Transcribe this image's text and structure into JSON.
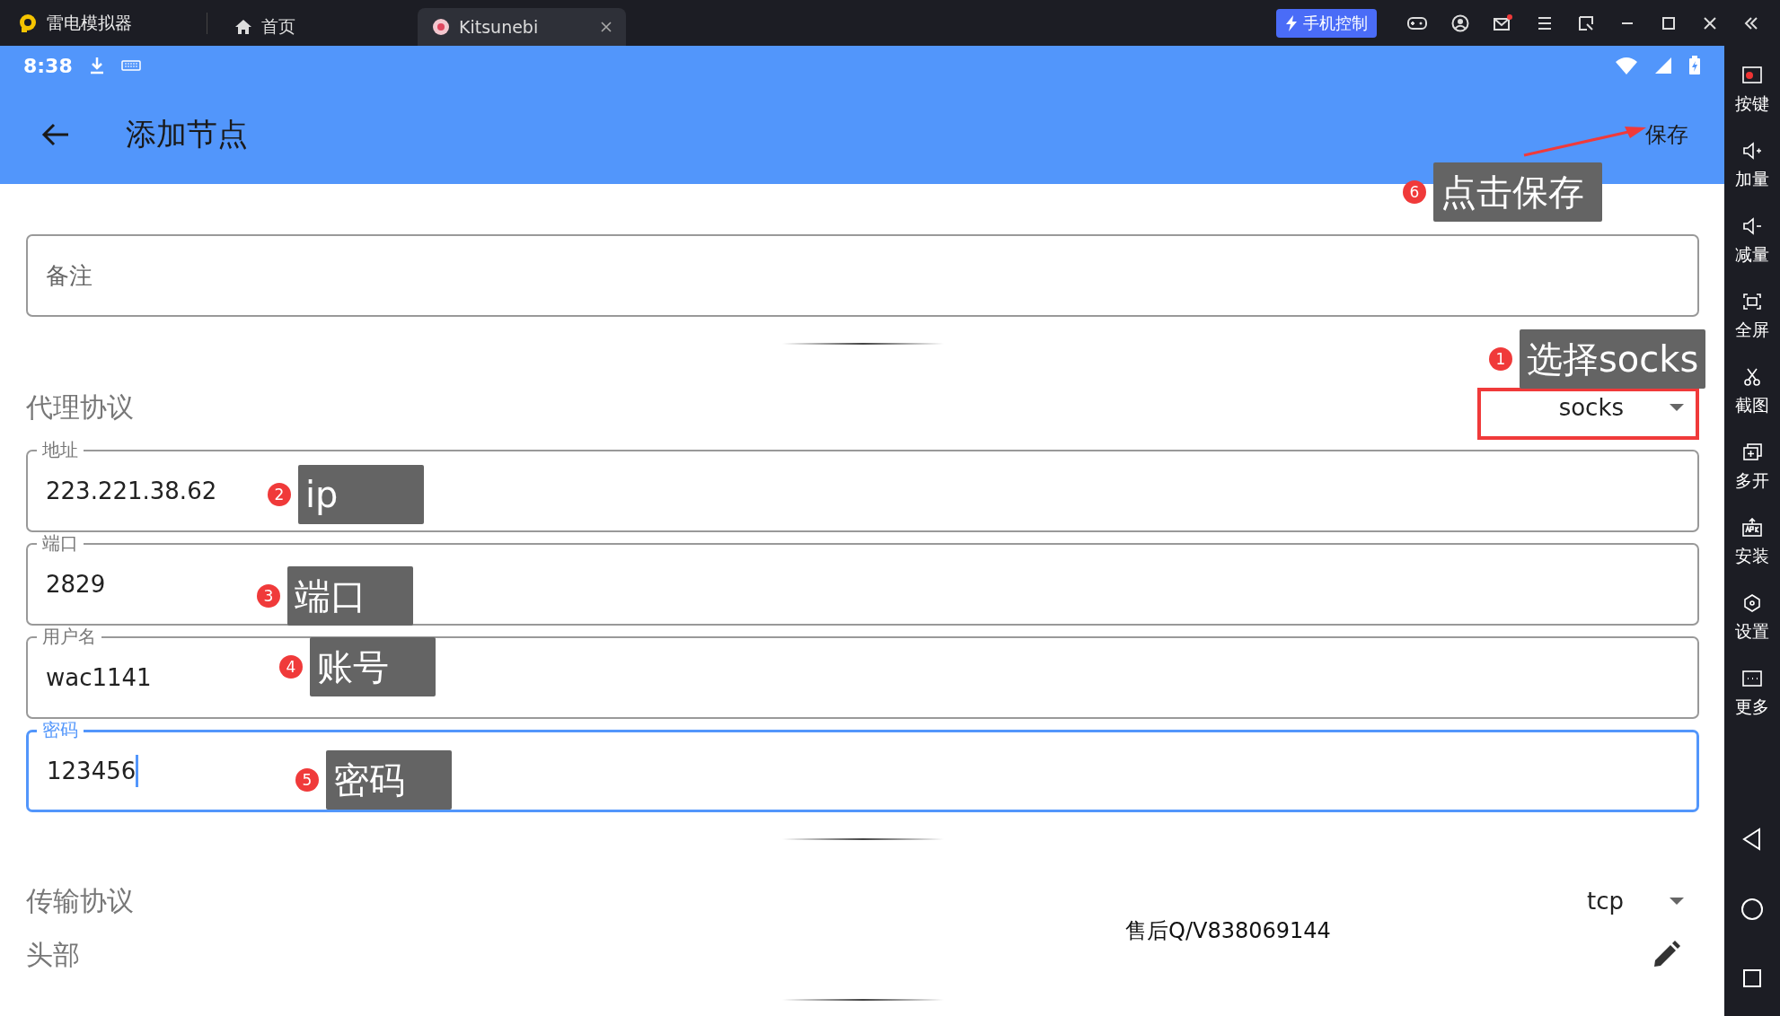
{
  "emulator": {
    "app_name": "雷电模拟器",
    "tabs": [
      {
        "label": "首页",
        "kind": "home",
        "selected": false
      },
      {
        "label": "Kitsunebi",
        "kind": "app",
        "selected": true
      }
    ],
    "control_button": "手机控制",
    "mail_unread": true,
    "sidebar": [
      {
        "label": "按键",
        "kind": "keys"
      },
      {
        "label": "加量",
        "kind": "vol-up"
      },
      {
        "label": "减量",
        "kind": "vol-down"
      },
      {
        "label": "全屏",
        "kind": "fullscreen"
      },
      {
        "label": "截图",
        "kind": "scissors"
      },
      {
        "label": "多开",
        "kind": "multi"
      },
      {
        "label": "安装",
        "kind": "apk"
      },
      {
        "label": "设置",
        "kind": "settings"
      },
      {
        "label": "更多",
        "kind": "more"
      }
    ]
  },
  "status_bar": {
    "time": "8:38"
  },
  "app_bar": {
    "title": "添加节点",
    "action": "保存"
  },
  "form": {
    "remark": {
      "placeholder": "备注"
    },
    "proxy_protocol": {
      "label": "代理协议",
      "value": "socks"
    },
    "fields": [
      {
        "label": "地址",
        "value": "223.221.38.62",
        "focused": false
      },
      {
        "label": "端口",
        "value": "2829",
        "focused": false
      },
      {
        "label": "用户名",
        "value": "wac1141",
        "focused": false
      },
      {
        "label": "密码",
        "value": "123456",
        "focused": true
      }
    ],
    "transport_protocol": {
      "label": "传输协议",
      "value": "tcp"
    },
    "header": {
      "label": "头部"
    }
  },
  "annotations": [
    {
      "number": "6",
      "text": "点击保存"
    },
    {
      "number": "1",
      "text": "选择socks"
    },
    {
      "number": "2",
      "text": "ip"
    },
    {
      "number": "3",
      "text": "端口"
    },
    {
      "number": "4",
      "text": "账号"
    },
    {
      "number": "5",
      "text": "密码"
    }
  ],
  "overlay_note": "售后Q/V838069144"
}
